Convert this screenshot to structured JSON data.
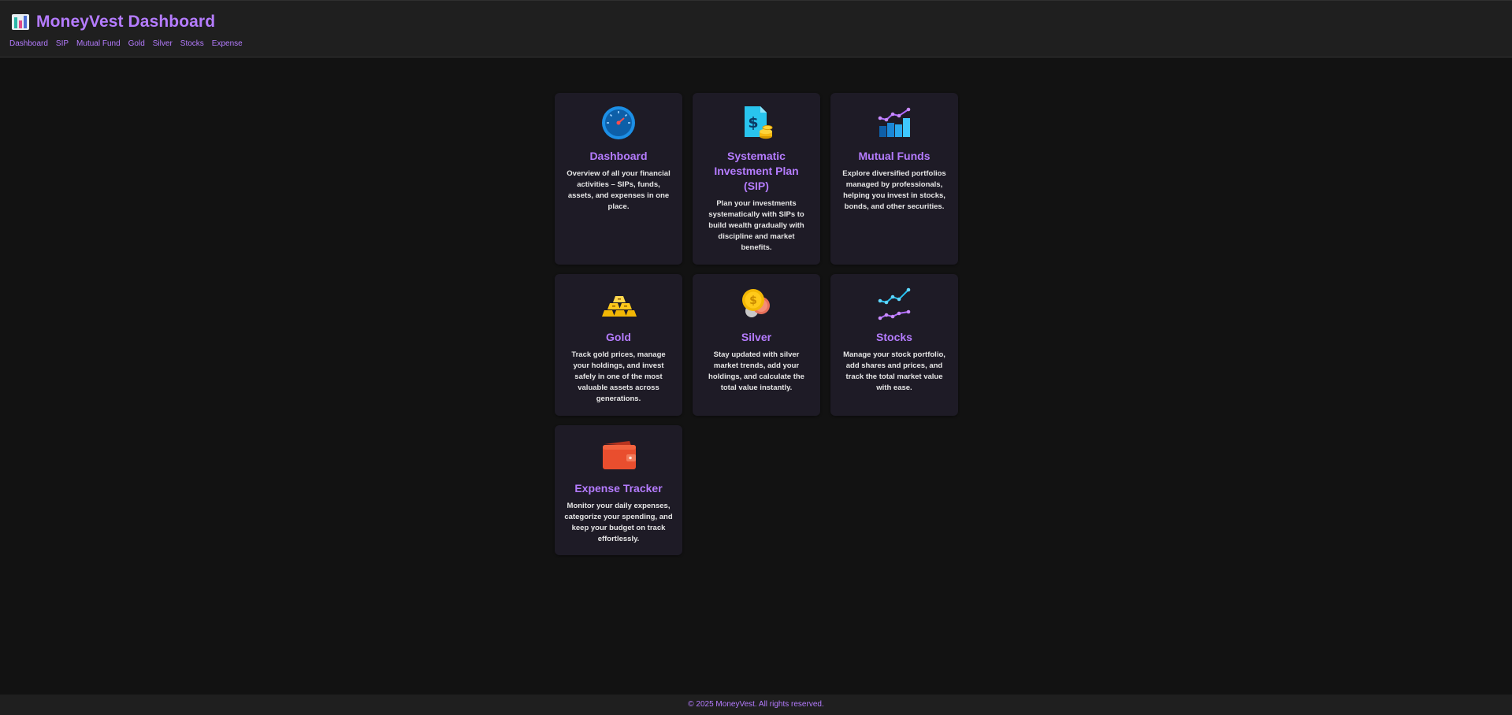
{
  "header": {
    "title": "MoneyVest Dashboard",
    "logo_icon": "bar-chart-icon",
    "nav": [
      "Dashboard",
      "SIP",
      "Mutual Fund",
      "Gold",
      "Silver",
      "Stocks",
      "Expense"
    ]
  },
  "cards": [
    {
      "title": "Dashboard",
      "description": "Overview of all your financial activities – SIPs, funds, assets, and expenses in one place.",
      "icon": "speedometer-icon"
    },
    {
      "title": "Systematic Investment Plan (SIP)",
      "description": "Plan your investments systematically with SIPs to build wealth gradually with discipline and market benefits.",
      "icon": "dollar-document-coins-icon"
    },
    {
      "title": "Mutual Funds",
      "description": "Explore diversified portfolios managed by professionals, helping you invest in stocks, bonds, and other securities.",
      "icon": "growth-chart-icon"
    },
    {
      "title": "Gold",
      "description": "Track gold prices, manage your holdings, and invest safely in one of the most valuable assets across generations.",
      "icon": "gold-bars-icon"
    },
    {
      "title": "Silver",
      "description": "Stay updated with silver market trends, add your holdings, and calculate the total value instantly.",
      "icon": "coins-icon"
    },
    {
      "title": "Stocks",
      "description": "Manage your stock portfolio, add shares and prices, and track the total market value with ease.",
      "icon": "stock-lines-icon"
    },
    {
      "title": "Expense Tracker",
      "description": "Monitor your daily expenses, categorize your spending, and keep your budget on track effortlessly.",
      "icon": "wallet-icon"
    }
  ],
  "footer": {
    "text": "© 2025 MoneyVest. All rights reserved."
  },
  "colors": {
    "accent": "#b57cff",
    "background": "#121212",
    "header": "#1f1f1f",
    "card": "#1e1b26"
  }
}
